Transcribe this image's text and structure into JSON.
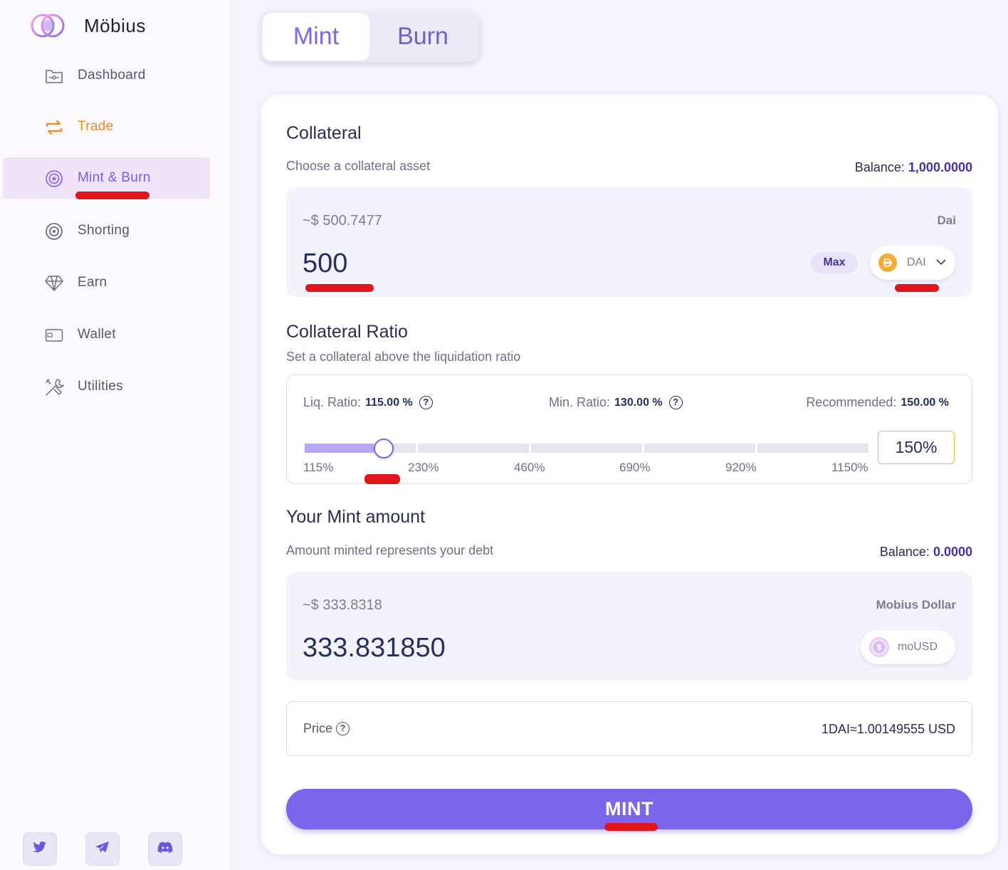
{
  "app": {
    "name": "Möbius"
  },
  "sidebar": {
    "items": [
      {
        "label": "Dashboard",
        "icon": "folder-icon"
      },
      {
        "label": "Trade",
        "icon": "swap-icon"
      },
      {
        "label": "Mint & Burn",
        "icon": "target-icon"
      },
      {
        "label": "Shorting",
        "icon": "shorting-icon"
      },
      {
        "label": "Earn",
        "icon": "diamond-icon"
      },
      {
        "label": "Wallet",
        "icon": "wallet-icon"
      },
      {
        "label": "Utilities",
        "icon": "tools-icon"
      }
    ],
    "active_index": 2,
    "social": [
      "twitter-icon",
      "telegram-icon",
      "discord-icon"
    ]
  },
  "tabs": {
    "mint": "Mint",
    "burn": "Burn",
    "active": "Mint"
  },
  "collateral": {
    "title": "Collateral",
    "subtitle": "Choose a collateral asset",
    "balance_label": "Balance:",
    "balance_value": "1,000.0000",
    "usd_value": "~$ 500.7477",
    "token_name": "Dai",
    "amount": "500",
    "max_label": "Max",
    "token_symbol": "DAI"
  },
  "ratio": {
    "title": "Collateral Ratio",
    "subtitle": "Set a collateral above the liquidation ratio",
    "liq_label": "Liq. Ratio:",
    "liq_value": "115.00 %",
    "min_label": "Min. Ratio:",
    "min_value": "130.00 %",
    "rec_label": "Recommended:",
    "rec_value": "150.00 %",
    "ticks": [
      "115%",
      "230%",
      "460%",
      "690%",
      "920%",
      "1150%"
    ],
    "selected": "150%",
    "slider_fraction": 0.14
  },
  "mint": {
    "title": "Your Mint amount",
    "subtitle": "Amount minted represents your debt",
    "balance_label": "Balance:",
    "balance_value": "0.0000",
    "usd_value": "~$ 333.8318",
    "token_name": "Mobius Dollar",
    "amount": "333.831850",
    "token_symbol": "moUSD"
  },
  "price": {
    "label": "Price",
    "value": "1DAI≈1.00149555 USD"
  },
  "action": {
    "label": "MINT"
  },
  "colors": {
    "accent": "#7a65ec",
    "orange": "#f08a1b",
    "annotation": "#e0161c"
  }
}
